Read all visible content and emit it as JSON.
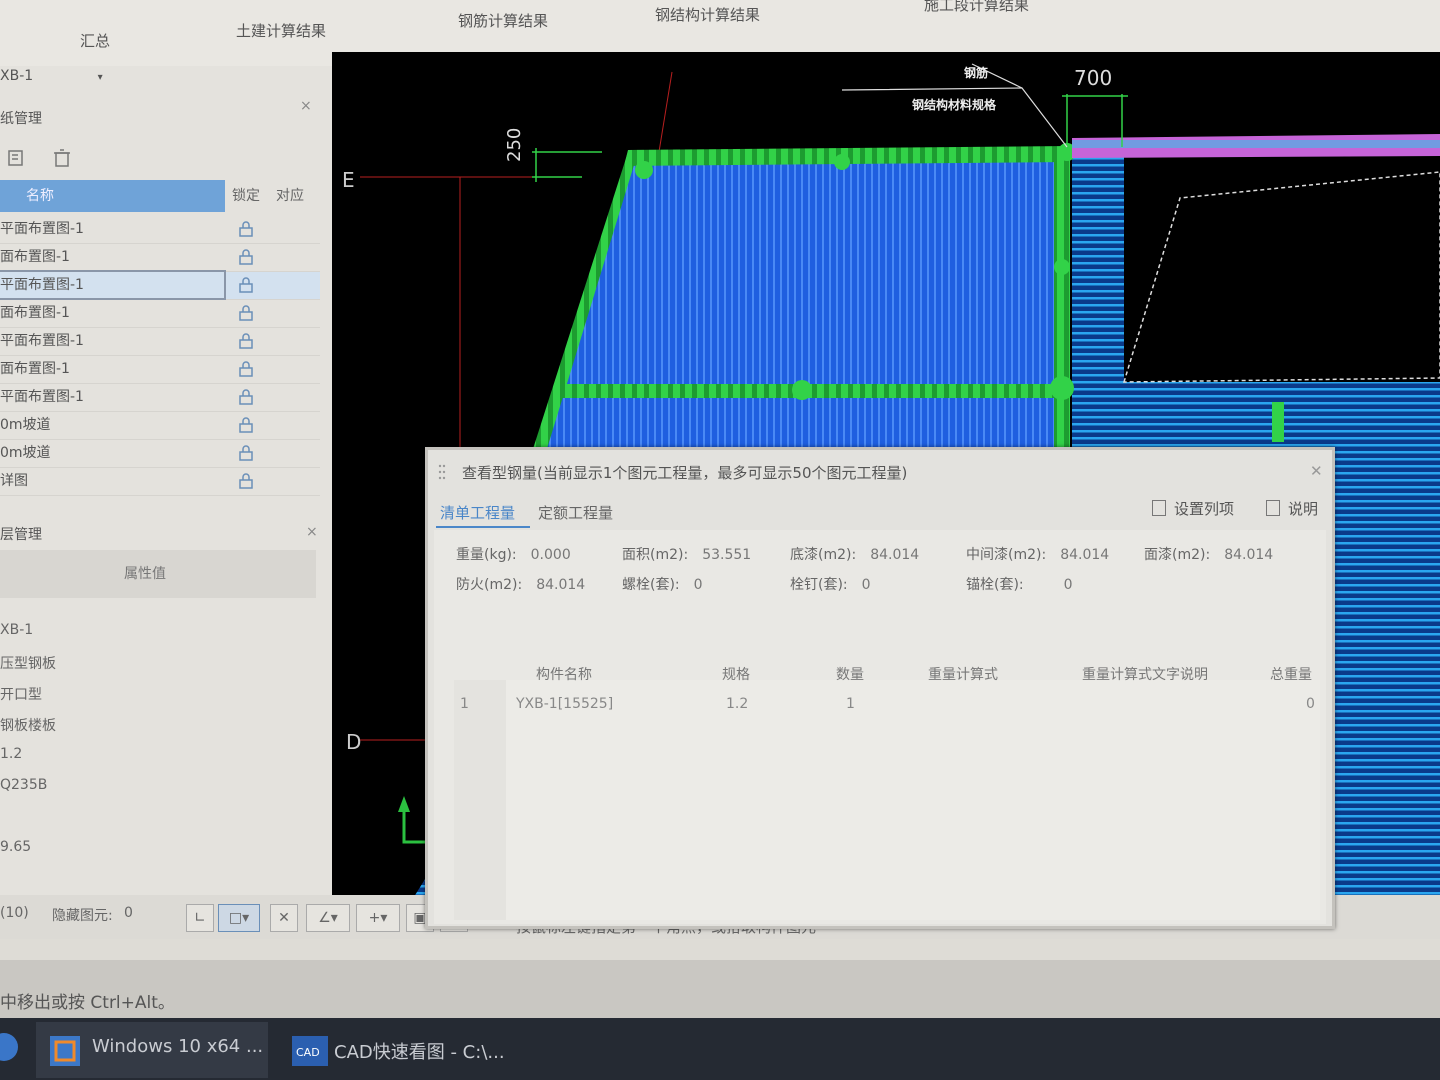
{
  "ribbon": {
    "tabs": [
      "汇总",
      "土建计算结果",
      "钢筋计算结果",
      "钢结构计算结果",
      "施工段计算结果"
    ]
  },
  "left_panel": {
    "component_dropdown": "XB-1",
    "drawing_panel_title": "纸管理",
    "drawing_columns": {
      "name": "名称",
      "lock": "锁定",
      "map": "对应"
    },
    "drawings": [
      "平面布置图-1",
      "面布置图-1",
      "平面布置图-1",
      "面布置图-1",
      "平面布置图-1",
      "面布置图-1",
      "平面布置图-1",
      "0m坡道",
      "0m坡道",
      "详图"
    ],
    "layer_panel_title": "层管理",
    "property_header": "属性值",
    "property_values": [
      "XB-1",
      "压型钢板",
      "开口型",
      "钢板楼板",
      "1.2",
      "Q235B",
      "",
      "9.65"
    ]
  },
  "status_bar": {
    "count": "(10)",
    "hidden_label": "隐藏图元:",
    "hidden_value": "0",
    "hint": "按鼠标左键指定第一个角点，或拾取构件图元"
  },
  "message_line": "中移出或按 Ctrl+Alt。",
  "taskbar": {
    "items": [
      "Windows 10 x64 ...",
      "CAD快速看图 - C:\\..."
    ]
  },
  "cad": {
    "axis_labels": [
      "E",
      "D"
    ],
    "dim_700": "700",
    "dim_250": "250",
    "annotation_1": "钢筋",
    "annotation_2": "钢结构材料规格",
    "colors": {
      "background": "#000000",
      "deck_fill": "#1f5fe0",
      "beam": "#32d248",
      "magenta_beam": "#c664d8",
      "stripe_blue": "#2aa6f0"
    }
  },
  "dialog": {
    "title": "查看型钢量(当前显示1个图元工程量，最多可显示50个图元工程量)",
    "tabs": [
      "清单工程量",
      "定额工程量"
    ],
    "btn_set_columns": "设置列项",
    "btn_help": "说明",
    "summary": [
      {
        "label": "重量(kg):",
        "value": "0.000"
      },
      {
        "label": "面积(m2):",
        "value": "53.551"
      },
      {
        "label": "底漆(m2):",
        "value": "84.014"
      },
      {
        "label": "中间漆(m2):",
        "value": "84.014"
      },
      {
        "label": "面漆(m2):",
        "value": "84.014"
      },
      {
        "label": "防火(m2):",
        "value": "84.014"
      },
      {
        "label": "螺栓(套):",
        "value": "0"
      },
      {
        "label": "栓钉(套):",
        "value": "0"
      },
      {
        "label": "锚栓(套):",
        "value": "0"
      }
    ],
    "table": {
      "columns": [
        "构件名称",
        "规格",
        "数量",
        "重量计算式",
        "重量计算式文字说明",
        "总重量"
      ],
      "rows": [
        {
          "index": "1",
          "name": "YXB-1[15525]",
          "spec": "1.2",
          "qty": "1",
          "formula": "",
          "formula_desc": "",
          "total": "0"
        }
      ]
    }
  }
}
